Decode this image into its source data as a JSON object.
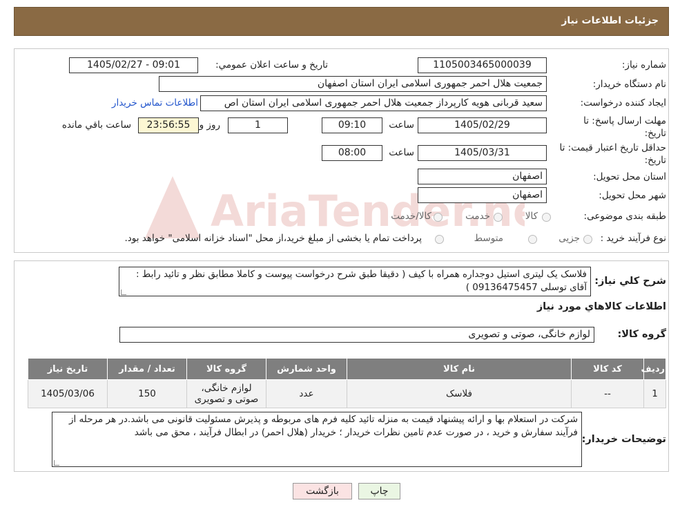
{
  "header": {
    "title": "جزئیات اطلاعات نیاز"
  },
  "watermark": {
    "text": "AriaTender.neT"
  },
  "form": {
    "need_number_label": "شماره نیاز:",
    "need_number": "1105003465000039",
    "announce_label": "تاریخ و ساعت اعلان عمومي:",
    "announce_value": "1405/02/27 - 09:01",
    "buyer_org_label": "نام دستگاه خریدار:",
    "buyer_org": "جمعیت هلال احمر جمهوری اسلامی ایران استان اصفهان",
    "creator_label": "ایجاد کننده درخواست:",
    "creator": "سعید قربانی هویه کارپرداز جمعیت هلال احمر جمهوری اسلامی ایران استان اص",
    "contact_link": "اطلاعات تماس خریدار",
    "deadline_label": "مهلت ارسال پاسخ: تا تاریخ:",
    "deadline_date": "1405/02/29",
    "time_label": "ساعت",
    "deadline_time": "09:10",
    "days_value": "1",
    "days_label": "روز و",
    "remaining_time": "23:56:55",
    "remaining_label": "ساعت باقي مانده",
    "validity_label": "حداقل تاریخ اعتبار قیمت: تا تاریخ:",
    "validity_date": "1405/03/31",
    "validity_time": "08:00",
    "province_label": "استان محل تحویل:",
    "province": "اصفهان",
    "city_label": "شهر محل تحویل:",
    "city": "اصفهان",
    "category_label": "طبقه بندی موضوعی:",
    "category_options": [
      "کالا",
      "خدمت",
      "کالا/خدمت"
    ],
    "process_label": "نوع فرآیند خرید :",
    "process_options": [
      "جزیی",
      "متوسط"
    ],
    "process_note": "پرداخت تمام یا بخشی از مبلغ خرید،از محل \"اسناد خزانه اسلامی\" خواهد بود."
  },
  "description": {
    "label": "شرح کلي نیاز:",
    "text": "فلاسک یک لیتری استیل دوجداره همراه با کیف ( دقیقا طبق شرح درخواست پیوست و کاملا مطابق نظر و تائید رابط : آقای توسلی 09136475457 )"
  },
  "goods": {
    "section_title": "اطلاعات کالاهاي مورد نیاز",
    "group_label": "گروه کالا:",
    "group_value": "لوازم خانگی، صوتی و تصویری",
    "columns": [
      "ردیف",
      "کد کالا",
      "نام کالا",
      "واحد شمارش",
      "گروه کالا",
      "تعداد / مقدار",
      "تاریخ نیاز"
    ],
    "rows": [
      [
        "1",
        "--",
        "فلاسک",
        "عدد",
        "لوازم خانگی، صوتی و تصویری",
        "150",
        "1405/03/06"
      ]
    ]
  },
  "buyer_notes": {
    "label": "توضیحات خریدار:",
    "text": "شرکت در استعلام بها و ارائه پیشنهاد قیمت به منزله تائید کلیه فرم های مربوطه و پذیرش مسئولیت قانونی می باشد.در هر مرحله از فرآیند سفارش و خرید ، در صورت عدم تامین نظرات خریدار ؛ خریدار (هلال احمر) در ابطال فرآیند ، محق می باشد"
  },
  "buttons": {
    "print": "چاپ",
    "back": "بازگشت"
  }
}
